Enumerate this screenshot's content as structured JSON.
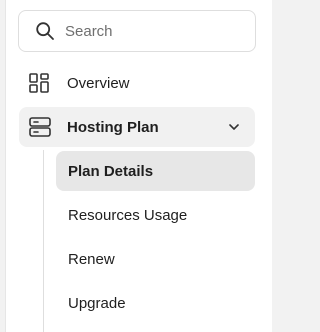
{
  "search": {
    "placeholder": "Search",
    "icon": "search-icon"
  },
  "nav": {
    "overview": {
      "label": "Overview",
      "icon": "grid-icon"
    },
    "hosting_plan": {
      "label": "Hosting Plan",
      "icon": "server-icon",
      "expanded": true,
      "children": [
        {
          "label": "Plan Details",
          "active": true
        },
        {
          "label": "Resources Usage",
          "active": false
        },
        {
          "label": "Renew",
          "active": false
        },
        {
          "label": "Upgrade",
          "active": false
        }
      ]
    }
  },
  "colors": {
    "panel_bg": "#ffffff",
    "outer_bg": "#f2f2f2",
    "section_bg": "#f1f1f1",
    "active_bg": "#e7e7e7",
    "text": "#1f1f1f",
    "border": "#dedede"
  }
}
